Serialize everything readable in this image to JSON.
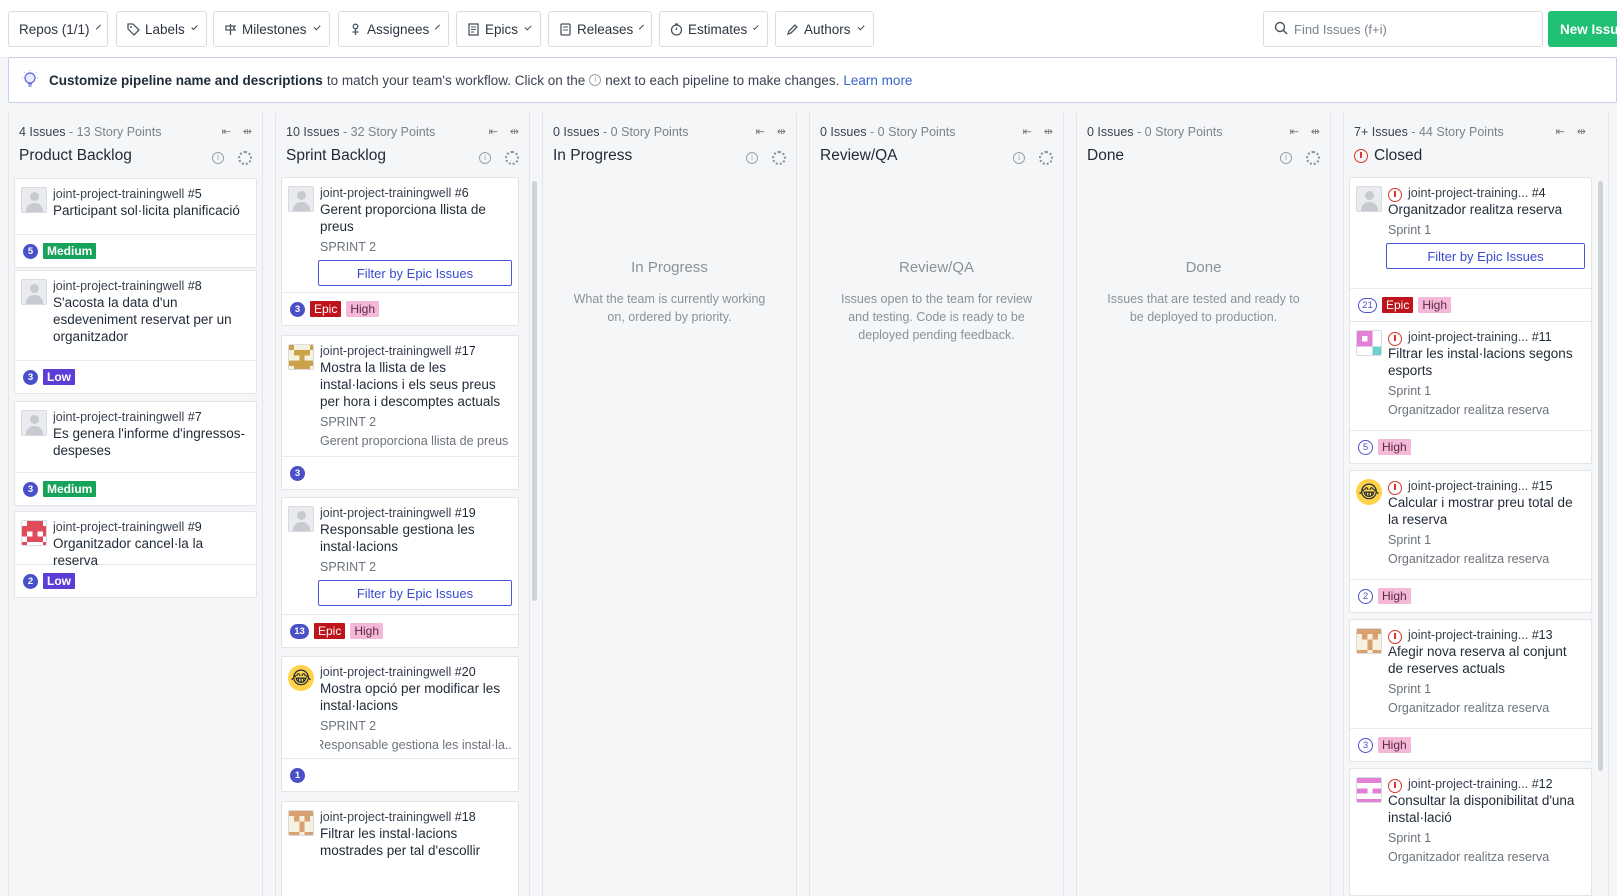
{
  "toolbar": {
    "filters": [
      {
        "label": "Repos (1/1)",
        "icon": ""
      },
      {
        "label": "Labels",
        "icon": "tag-icon"
      },
      {
        "label": "Milestones",
        "icon": "milestone-icon"
      },
      {
        "label": "Assignees",
        "icon": "assignee-icon"
      },
      {
        "label": "Epics",
        "icon": "epic-icon"
      },
      {
        "label": "Releases",
        "icon": "release-icon"
      },
      {
        "label": "Estimates",
        "icon": "estimate-icon"
      },
      {
        "label": "Authors",
        "icon": "pencil-icon"
      }
    ],
    "search_placeholder": "Find Issues (f+i)",
    "new_issue": "New Issue"
  },
  "banner": {
    "bold": "Customize pipeline name and descriptions",
    "text1": "to match your team's workflow. Click on the",
    "text2": "next to each pipeline to make changes.",
    "link": "Learn more"
  },
  "columns": [
    {
      "issues": "4 Issues",
      "points": "- 13 Story Points",
      "title": "Product Backlog"
    },
    {
      "issues": "10 Issues",
      "points": "- 32 Story Points",
      "title": "Sprint Backlog"
    },
    {
      "issues": "0 Issues",
      "points": "- 0 Story Points",
      "title": "In Progress",
      "empty_title": "In Progress",
      "empty_desc": "What the team is currently working on, ordered by priority."
    },
    {
      "issues": "0 Issues",
      "points": "- 0 Story Points",
      "title": "Review/QA",
      "empty_title": "Review/QA",
      "empty_desc": "Issues open to the team for review and testing. Code is ready to be deployed pending feedback."
    },
    {
      "issues": "0 Issues",
      "points": "- 0 Story Points",
      "title": "Done",
      "empty_title": "Done",
      "empty_desc": "Issues that are tested and ready to be deployed to production."
    },
    {
      "issues": "7+ Issues",
      "points": "- 44 Story Points",
      "title": "Closed"
    }
  ],
  "backlog": [
    {
      "repo": "joint-project-trainingwell",
      "num": "#5",
      "title": "Participant sol·licita planificació",
      "est": "5",
      "label": "Medium"
    },
    {
      "repo": "joint-project-trainingwell",
      "num": "#8",
      "title": "S'acosta la data d'un esdeveniment reservat per un organitzador",
      "est": "3",
      "label": "Low"
    },
    {
      "repo": "joint-project-trainingwell",
      "num": "#7",
      "title": "Es genera l'informe d'ingressos-despeses",
      "est": "3",
      "label": "Medium"
    },
    {
      "repo": "joint-project-trainingwell",
      "num": "#9",
      "title": "Organitzador cancel·la la reserva",
      "est": "2",
      "label": "Low"
    }
  ],
  "sprint": [
    {
      "repo": "joint-project-trainingwell",
      "num": "#6",
      "title": "Gerent proporciona llista de preus",
      "milestone": "SPRINT 2",
      "epic_btn": "Filter by Epic Issues",
      "est": "3",
      "epic": "Epic",
      "label": "High"
    },
    {
      "repo": "joint-project-trainingwell",
      "num": "#17",
      "title": "Mostra la llista de les instal·lacions i els seus preus per hora i descomptes actuals",
      "milestone": "SPRINT 2",
      "parent": "Gerent proporciona llista de preus",
      "est": "3"
    },
    {
      "repo": "joint-project-trainingwell",
      "num": "#19",
      "title": "Responsable gestiona les instal·lacions",
      "milestone": "SPRINT 2",
      "epic_btn": "Filter by Epic Issues",
      "est": "13",
      "epic": "Epic",
      "label": "High"
    },
    {
      "repo": "joint-project-trainingwell",
      "num": "#20",
      "title": "Mostra opció per modificar les instal·lacions",
      "milestone": "SPRINT 2",
      "parent": "Responsable gestiona les instal·la...",
      "est": "1"
    },
    {
      "repo": "joint-project-trainingwell",
      "num": "#18",
      "title": "Filtrar les instal·lacions mostrades per tal d'escollir"
    }
  ],
  "closed": [
    {
      "repo": "joint-project-training...",
      "num": "#4",
      "title": "Organitzador realitza reserva",
      "milestone": "Sprint 1",
      "epic_btn": "Filter by Epic Issues",
      "est": "21",
      "epic": "Epic",
      "label": "High"
    },
    {
      "repo": "joint-project-training...",
      "num": "#11",
      "title": "Filtrar les instal·lacions segons esports",
      "milestone": "Sprint 1",
      "parent": "Organitzador realitza reserva",
      "est": "5",
      "label": "High"
    },
    {
      "repo": "joint-project-training...",
      "num": "#15",
      "title": "Calcular i mostrar preu total de la reserva",
      "milestone": "Sprint 1",
      "parent": "Organitzador realitza reserva",
      "est": "2",
      "label": "High"
    },
    {
      "repo": "joint-project-training...",
      "num": "#13",
      "title": "Afegir nova reserva al conjunt de reserves actuals",
      "milestone": "Sprint 1",
      "parent": "Organitzador realitza reserva",
      "est": "3",
      "label": "High"
    },
    {
      "repo": "joint-project-training...",
      "num": "#12",
      "title": "Consultar la disponibilitat d'una instal·lació",
      "milestone": "Sprint 1",
      "parent": "Organitzador realitza reserva"
    }
  ],
  "colors": {
    "accent": "#1fbf74",
    "link": "#3a63c8",
    "epic": "#c0141c",
    "high": "#f4b8d8",
    "medium": "#18a35a",
    "low": "#5c3ed6",
    "estimate": "#4a50c8",
    "closed": "#d9362c"
  }
}
